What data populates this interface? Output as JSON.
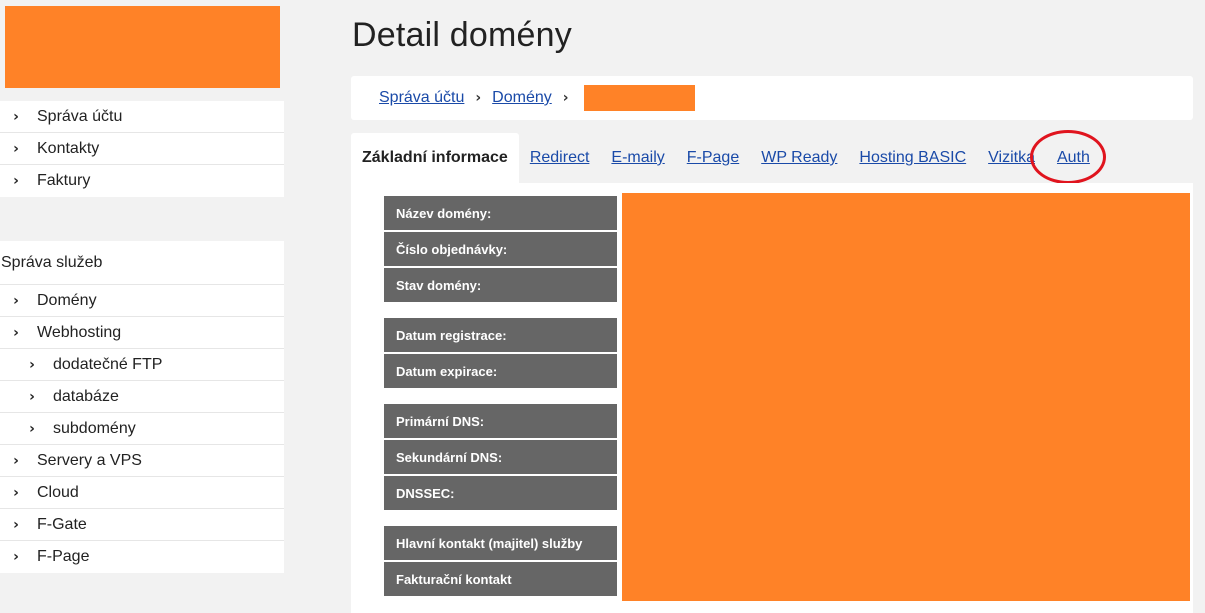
{
  "sidebar": {
    "account_items": [
      {
        "label": "Správa účtu"
      },
      {
        "label": "Kontakty"
      },
      {
        "label": "Faktury"
      }
    ],
    "services_heading": "Správa služeb",
    "service_items": [
      {
        "label": "Domény"
      },
      {
        "label": "Webhosting"
      },
      {
        "label": "dodatečné FTP"
      },
      {
        "label": "databáze"
      },
      {
        "label": "subdomény"
      },
      {
        "label": "Servery a VPS"
      },
      {
        "label": "Cloud"
      },
      {
        "label": "F-Gate"
      },
      {
        "label": "F-Page"
      }
    ]
  },
  "page": {
    "title": "Detail domény"
  },
  "breadcrumb": {
    "items": [
      {
        "label": "Správa účtu"
      },
      {
        "label": "Domény"
      }
    ]
  },
  "tabs": [
    {
      "label": "Základní informace"
    },
    {
      "label": "Redirect"
    },
    {
      "label": "E-maily"
    },
    {
      "label": "F-Page"
    },
    {
      "label": "WP Ready"
    },
    {
      "label": "Hosting BASIC"
    },
    {
      "label": "Vizitka"
    },
    {
      "label": "Auth"
    }
  ],
  "details": {
    "labels": [
      "Název domény:",
      "Číslo objednávky:",
      "Stav domény:",
      "Datum registrace:",
      "Datum expirace:",
      "Primární DNS:",
      "Sekundární DNS:",
      "DNSSEC:",
      "Hlavní kontakt (majitel) služby",
      "Fakturační kontakt"
    ]
  },
  "colors": {
    "redaction": "#ff8227",
    "label_bg": "#666666",
    "link": "#1a4aa8",
    "highlight": "#e0141e"
  },
  "icons": {
    "chevron": "chevron-right-icon"
  }
}
